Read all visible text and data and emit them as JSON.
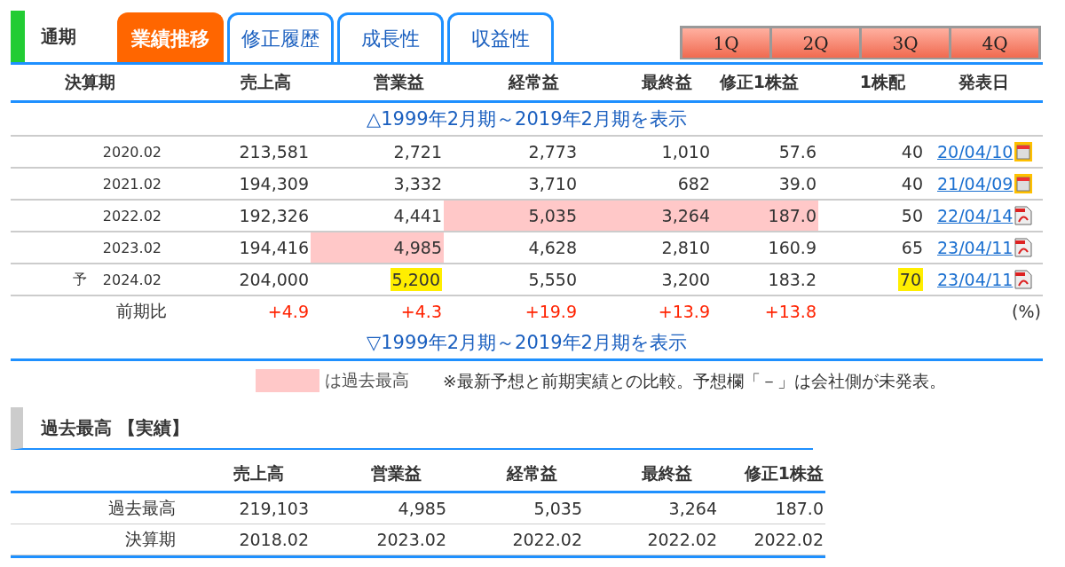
{
  "period_label": "通期",
  "tabs": [
    {
      "label": "業績推移",
      "selected": true
    },
    {
      "label": "修正履歴",
      "selected": false
    },
    {
      "label": "成長性",
      "selected": false
    },
    {
      "label": "収益性",
      "selected": false
    }
  ],
  "quarter_buttons": [
    "1Q",
    "2Q",
    "3Q",
    "4Q"
  ],
  "table": {
    "columns": [
      "決算期",
      "売上高",
      "営業益",
      "経常益",
      "最終益",
      "修正1株益",
      "1株配",
      "発表日"
    ],
    "show_older_top": "△1999年2月期～2019年2月期を表示",
    "rows": [
      {
        "prefix": "",
        "cells": [
          {
            "text": "2020.02"
          },
          {
            "text": "213,581",
            "record": false,
            "revised": false
          },
          {
            "text": "2,721",
            "record": false,
            "revised": false
          },
          {
            "text": "2,773",
            "record": false,
            "revised": false
          },
          {
            "text": "1,010",
            "record": false,
            "revised": false
          },
          {
            "text": "57.6",
            "record": false,
            "revised": false
          },
          {
            "text": "40",
            "record": false,
            "revised": false
          },
          {
            "text": "20/04/10",
            "kind": "calendar"
          }
        ]
      },
      {
        "prefix": "",
        "cells": [
          {
            "text": "2021.02"
          },
          {
            "text": "194,309",
            "record": false,
            "revised": false
          },
          {
            "text": "3,332",
            "record": false,
            "revised": false
          },
          {
            "text": "3,710",
            "record": false,
            "revised": false
          },
          {
            "text": "682",
            "record": false,
            "revised": false
          },
          {
            "text": "39.0",
            "record": false,
            "revised": false
          },
          {
            "text": "40",
            "record": false,
            "revised": false
          },
          {
            "text": "21/04/09",
            "kind": "calendar"
          }
        ]
      },
      {
        "prefix": "",
        "cells": [
          {
            "text": "2022.02"
          },
          {
            "text": "192,326",
            "record": false,
            "revised": false
          },
          {
            "text": "4,441",
            "record": false,
            "revised": false
          },
          {
            "text": "5,035",
            "record": true,
            "revised": false
          },
          {
            "text": "3,264",
            "record": true,
            "revised": false
          },
          {
            "text": "187.0",
            "record": true,
            "revised": false
          },
          {
            "text": "50",
            "record": false,
            "revised": false
          },
          {
            "text": "22/04/14",
            "kind": "pdf"
          }
        ]
      },
      {
        "prefix": "",
        "cells": [
          {
            "text": "2023.02"
          },
          {
            "text": "194,416",
            "record": false,
            "revised": false
          },
          {
            "text": "4,985",
            "record": true,
            "revised": false
          },
          {
            "text": "4,628",
            "record": false,
            "revised": false
          },
          {
            "text": "2,810",
            "record": false,
            "revised": false
          },
          {
            "text": "160.9",
            "record": false,
            "revised": false
          },
          {
            "text": "65",
            "record": false,
            "revised": false
          },
          {
            "text": "23/04/11",
            "kind": "pdf"
          }
        ]
      },
      {
        "prefix": "予",
        "cells": [
          {
            "text": "2024.02"
          },
          {
            "text": "204,000",
            "record": false,
            "revised": false
          },
          {
            "text": "5,200",
            "record": false,
            "revised": true
          },
          {
            "text": "5,550",
            "record": false,
            "revised": false
          },
          {
            "text": "3,200",
            "record": false,
            "revised": false
          },
          {
            "text": "183.2",
            "record": false,
            "revised": false
          },
          {
            "text": "70",
            "record": false,
            "revised": true
          },
          {
            "text": "23/04/11",
            "kind": "pdf"
          }
        ]
      }
    ],
    "change_row": {
      "label": "前期比",
      "values": [
        "+4.9",
        "+4.3",
        "+19.9",
        "+13.9",
        "+13.8"
      ],
      "unit": "(%)"
    },
    "show_older_bottom": "▽1999年2月期～2019年2月期を表示"
  },
  "legend": {
    "label": "は過去最高",
    "note": "※最新予想と前期実績との比較。予想欄「－」は会社側が未発表。"
  },
  "record_section": {
    "title": "過去最高 【実績】",
    "columns": [
      "",
      "売上高",
      "営業益",
      "経常益",
      "最終益",
      "修正1株益"
    ],
    "rows": [
      {
        "cells": [
          "過去最高",
          "219,103",
          "4,985",
          "5,035",
          "3,264",
          "187.0"
        ]
      },
      {
        "cells": [
          "決算期",
          "2018.02",
          "2023.02",
          "2022.02",
          "2022.02",
          "2022.02"
        ]
      }
    ]
  }
}
